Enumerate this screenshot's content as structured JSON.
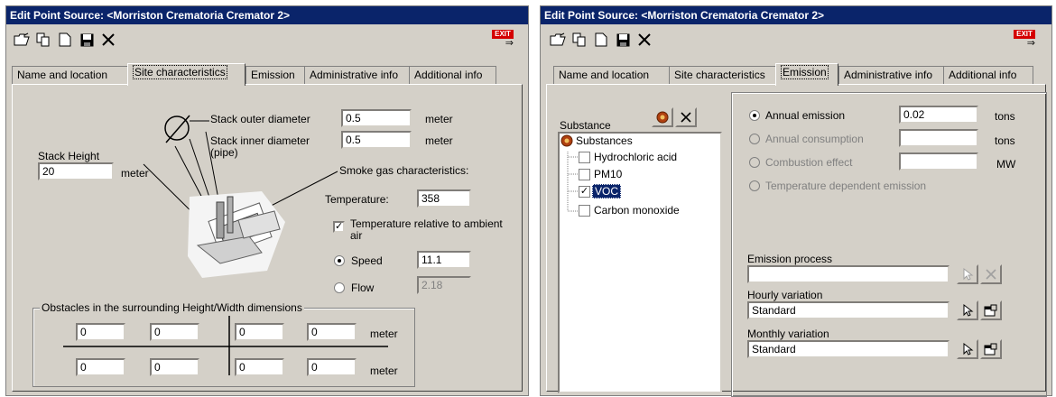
{
  "left": {
    "title": "Edit Point Source: <Morriston Crematoria Cremator 2>",
    "toolbar": {
      "exit_label": "EXIT"
    },
    "tabs": [
      "Name and location",
      "Site characteristics",
      "Emission",
      "Administrative info",
      "Additional info"
    ],
    "site": {
      "stack_height_label": "Stack Height",
      "stack_height_value": "20",
      "stack_height_unit": "meter",
      "outer_diameter_label": "Stack outer diameter",
      "outer_diameter_value": "0.5",
      "outer_diameter_unit": "meter",
      "inner_diameter_label": "Stack inner diameter",
      "inner_diameter_label2": "(pipe)",
      "inner_diameter_value": "0.5",
      "inner_diameter_unit": "meter",
      "smoke_label": "Smoke gas characteristics:",
      "temperature_label": "Temperature:",
      "temperature_value": "358",
      "temp_relative_label": "Temperature relative to ambient",
      "temp_relative_label2": "air",
      "speed_label": "Speed",
      "speed_value": "11.1",
      "flow_label": "Flow",
      "flow_value": "2.18",
      "obstacles_label": "Obstacles in the surrounding Height/Width dimensions",
      "obstacles_row1": [
        "0",
        "0",
        "0",
        "0"
      ],
      "obstacles_row2": [
        "0",
        "0",
        "0",
        "0"
      ],
      "obstacles_unit": "meter"
    }
  },
  "right": {
    "title": "Edit Point Source: <Morriston Crematoria Cremator 2>",
    "toolbar": {
      "exit_label": "EXIT"
    },
    "tabs": [
      "Name and location",
      "Site characteristics",
      "Emission",
      "Administrative info",
      "Additional info"
    ],
    "emission": {
      "substance_label": "Substance",
      "tree_root": "Substances",
      "substances": [
        "Hydrochloric acid",
        "PM10",
        "VOC",
        "Carbon monoxide"
      ],
      "annual_emission_label": "Annual emission",
      "annual_emission_value": "0.02",
      "annual_emission_unit": "tons",
      "annual_consumption_label": "Annual consumption",
      "annual_consumption_unit": "tons",
      "combustion_label": "Combustion effect",
      "combustion_unit": "MW",
      "temp_dependent_label": "Temperature dependent emission",
      "emission_process_label": "Emission process",
      "emission_process_value": "",
      "hourly_label": "Hourly variation",
      "hourly_value": "Standard",
      "monthly_label": "Monthly variation",
      "monthly_value": "Standard"
    }
  }
}
